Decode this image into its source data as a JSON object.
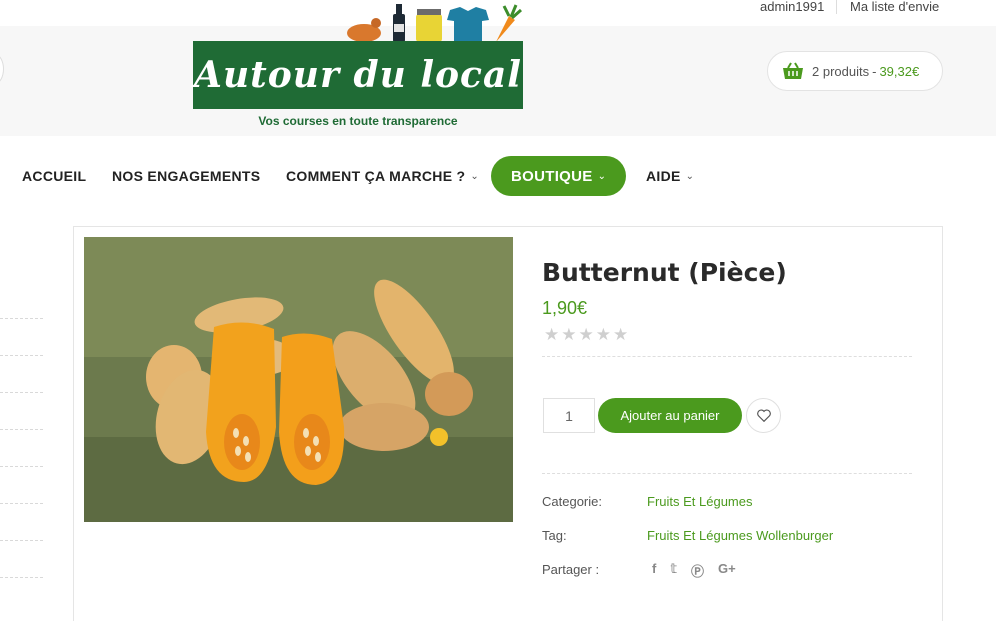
{
  "topbar": {
    "user": "admin1991",
    "wishlist": "Ma liste d'envie"
  },
  "logo": {
    "title": "Autour du local",
    "tagline": "Vos courses en toute transparence"
  },
  "cart": {
    "count": "2 produits",
    "separator": "-",
    "total": "39,32€"
  },
  "nav": {
    "items": [
      {
        "label": "ACCUEIL"
      },
      {
        "label": "NOS ENGAGEMENTS"
      },
      {
        "label": "COMMENT ÇA MARCHE ?"
      },
      {
        "label": "BOUTIQUE"
      },
      {
        "label": "AIDE"
      }
    ]
  },
  "product": {
    "title": "Butternut (Pièce)",
    "price": "1,90€",
    "rating": 0,
    "rating_max": 5,
    "quantity": "1",
    "add_to_cart": "Ajouter au panier",
    "meta": {
      "category_label": "Categorie:",
      "category_value": "Fruits Et Légumes",
      "tag_label": "Tag:",
      "tag_value": "Fruits Et Légumes Wollenburger",
      "share_label": "Partager :"
    },
    "share_icons": [
      "facebook-icon",
      "twitter-icon",
      "pinterest-icon",
      "google-plus-icon"
    ]
  },
  "colors": {
    "accent": "#4b9a1e",
    "logo_green": "#1f6b35"
  }
}
